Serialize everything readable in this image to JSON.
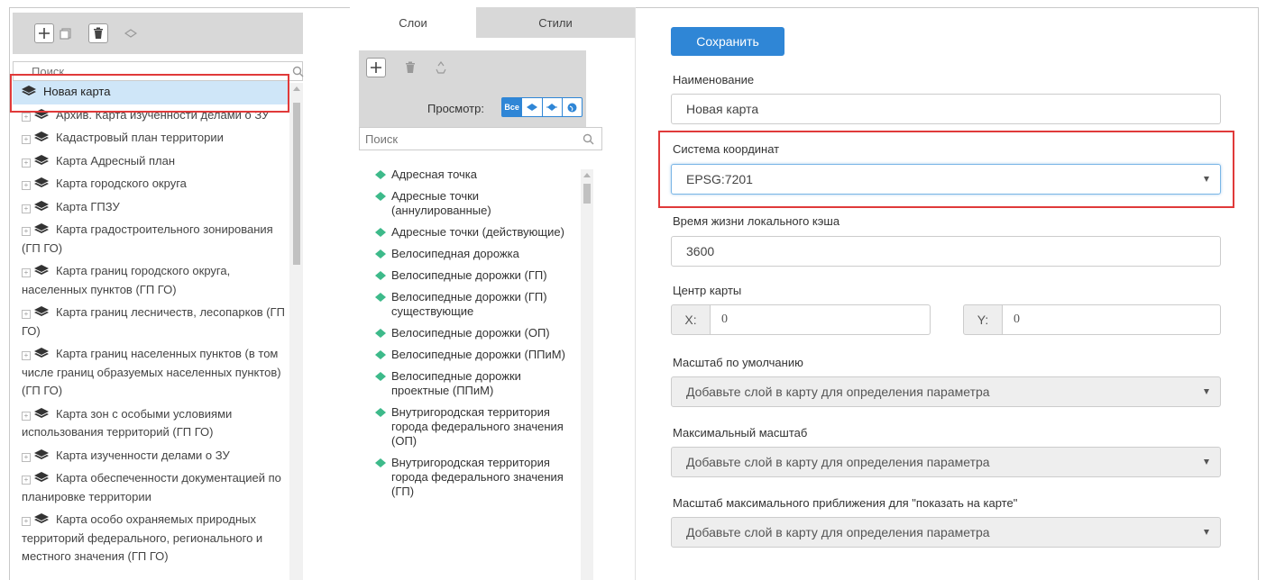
{
  "left_panel": {
    "search_placeholder": "Поиск",
    "tree": [
      {
        "label": "Новая карта",
        "selected": true,
        "expandable": false
      },
      {
        "label": "Архив. Карта изученности делами о ЗУ",
        "expandable": true
      },
      {
        "label": "Кадастровый план территории",
        "expandable": true
      },
      {
        "label": "Карта Адресный план",
        "expandable": true
      },
      {
        "label": "Карта городского округа",
        "expandable": true
      },
      {
        "label": "Карта ГПЗУ",
        "expandable": true
      },
      {
        "label": "Карта градостроительного зонирования (ГП ГО)",
        "expandable": true
      },
      {
        "label": "Карта границ городского округа, населенных пунктов (ГП ГО)",
        "expandable": true
      },
      {
        "label": "Карта границ лесничеств, лесопарков (ГП ГО)",
        "expandable": true
      },
      {
        "label": "Карта границ населенных пунктов (в том числе границ образуемых населенных пунктов) (ГП ГО)",
        "expandable": true
      },
      {
        "label": "Карта зон с особыми условиями использования территорий (ГП ГО)",
        "expandable": true
      },
      {
        "label": "Карта изученности делами о ЗУ",
        "expandable": true
      },
      {
        "label": "Карта обеспеченности документацией по планировке территории",
        "expandable": true
      },
      {
        "label": "Карта особо охраняемых природных территорий федерального, регионального и местного значения (ГП ГО)",
        "expandable": true
      }
    ]
  },
  "middle_panel": {
    "tabs": [
      "Слои",
      "Стили"
    ],
    "view_label": "Просмотр:",
    "view_all": "Все",
    "search_placeholder": "Поиск",
    "layers": [
      "Адресная точка",
      "Адресные точки (аннулированные)",
      "Адресные точки (действующие)",
      "Велосипедная дорожка",
      "Велосипедные дорожки (ГП)",
      "Велосипедные дорожки (ГП) существующие",
      "Велосипедные дорожки (ОП)",
      "Велосипедные дорожки (ППиМ)",
      "Велосипедные дорожки проектные (ППиМ)",
      "Внутригородская территория города федерального значения (ОП)",
      "Внутригородская территория города федерального значения (ГП)"
    ]
  },
  "form": {
    "save_label": "Сохранить",
    "name_label": "Наименование",
    "name_value": "Новая карта",
    "crs_label": "Система координат",
    "crs_value": "EPSG:7201",
    "cache_label": "Время жизни локального кэша",
    "cache_value": "3600",
    "center_label": "Центр карты",
    "x_label": "X:",
    "x_value": "0",
    "y_label": "Y:",
    "y_value": "0",
    "default_scale_label": "Масштаб по умолчанию",
    "max_scale_label": "Максимальный масштаб",
    "zoom_scale_label": "Масштаб максимального приближения для \"показать на карте\"",
    "disabled_hint": "Добавьте слой в карту для определения параметра"
  },
  "colors": {
    "accent": "#2f86d6",
    "highlight_box": "#e03a3a",
    "selected_row": "#cfe6f8",
    "toolbar_bg": "#d8d8d8",
    "layer_diamond": "#3dba8a"
  }
}
